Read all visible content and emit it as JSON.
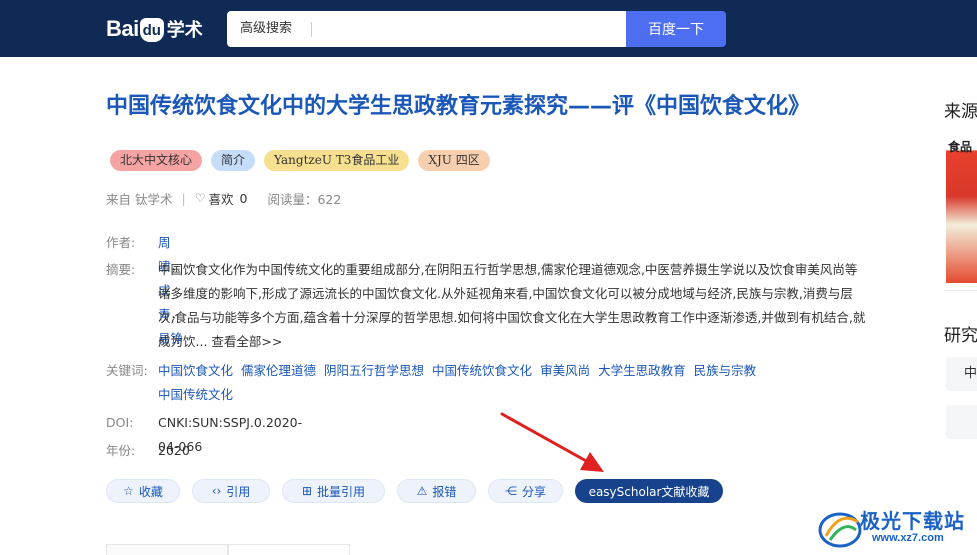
{
  "header": {
    "logo_bai": "Bai",
    "logo_du": "du",
    "logo_xueshu": "学术",
    "advanced_search": "高级搜索",
    "search_value": "",
    "search_button": "百度一下"
  },
  "paper": {
    "title": "中国传统饮食文化中的大学生思政教育元素探究——评《中国饮食文化》",
    "tags": [
      "北大中文核心",
      "简介",
      "YangtzeU T3食品工业",
      "XJU 四区"
    ],
    "source_label": "来自 钛学术",
    "likes_label": "喜欢",
    "likes_count": "0",
    "reads": "阅读量：622",
    "authors_label": "作者:",
    "authors": [
      "周啸",
      "成青",
      "易铮"
    ],
    "abstract_label": "摘要:",
    "abstract_text": "中国饮食文化作为中国传统文化的重要组成部分,在阴阳五行哲学思想,儒家伦理道德观念,中医营养摄生学说以及饮食审美风尚等诸多维度的影响下,形成了源远流长的中国饮食文化.从外延视角来看,中国饮食文化可以被分成地域与经济,民族与宗教,消费与层次,食品与功能等多个方面,蕴含着十分深厚的哲学思想.如何将中国饮食文化在大学生思政教育工作中逐渐渗透,并做到有机结合,就成为饮...",
    "abstract_more": "查看全部>>",
    "keywords_label": "关键词:",
    "keywords": [
      "中国饮食文化",
      "儒家伦理道德",
      "阴阳五行哲学思想",
      "中国传统饮食文化",
      "审美风尚",
      "大学生思政教育",
      "民族与宗教",
      "中国传统文化"
    ],
    "doi_label": "DOI:",
    "doi": "CNKI:SUN:SSPJ.0.2020-04-066",
    "year_label": "年份:",
    "year": "2020"
  },
  "actions": {
    "collect": "收藏",
    "cite": "引用",
    "batch_cite": "批量引用",
    "report": "报错",
    "share": "分享",
    "easyscholar": "easyScholar文献收藏"
  },
  "sidebar": {
    "source_heading": "来源",
    "cover_text": "食品",
    "research_heading": "研究",
    "box_text": "中"
  },
  "watermark": {
    "name": "极光下载站",
    "url": "www.xz7.com"
  },
  "colors": {
    "header_bg": "#0f2a54",
    "link_blue": "#1a57b8",
    "search_button": "#4e6ef2",
    "primary_action": "#16438c",
    "arrow_red": "#e02020"
  }
}
